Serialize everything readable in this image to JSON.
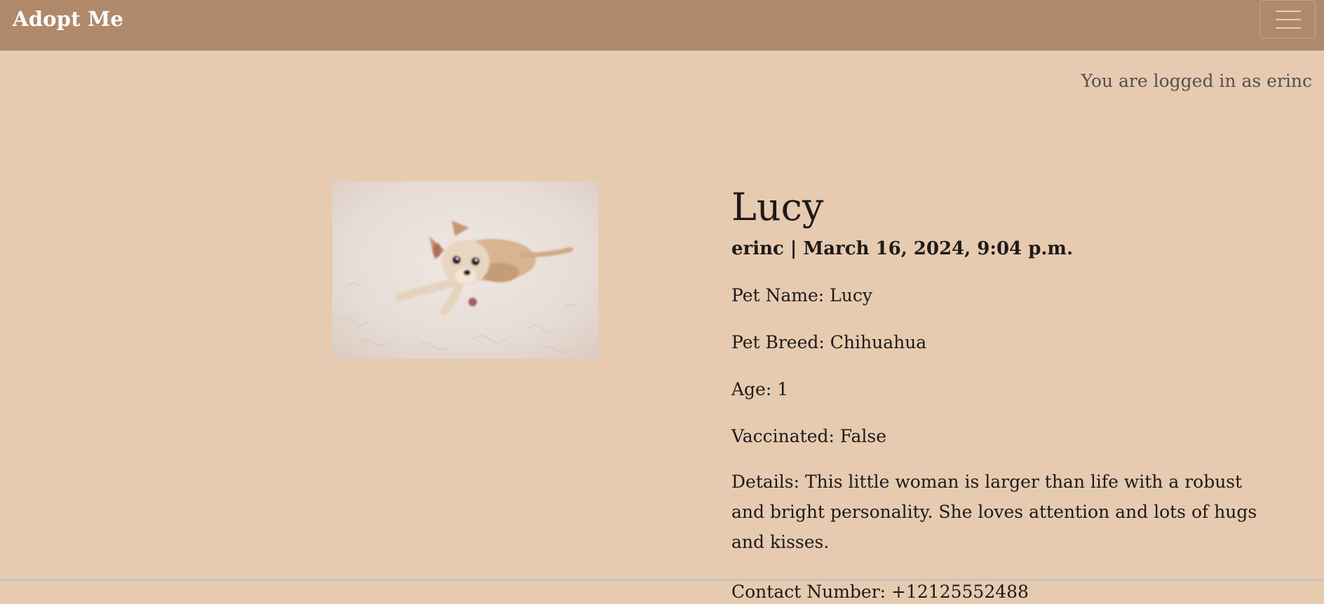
{
  "navbar": {
    "brand": "Adopt Me",
    "menu_icon": "hamburger-menu-icon"
  },
  "user": {
    "logged_in_text": "You are logged in as erinc"
  },
  "pet": {
    "image_alt": "Chihuahua dog lying on a white fluffy rug",
    "title": "Lucy",
    "meta": "erinc | March 16, 2024, 9:04 p.m.",
    "name_line": "Pet Name: Lucy",
    "breed_line": "Pet Breed: Chihuahua",
    "age_line": "Age: 1",
    "vaccinated_line": "Vaccinated: False",
    "details_line": "Details: This little woman is larger than life with a robust and bright personality. She loves attention and lots of hugs and kisses.",
    "contact_line": "Contact Number: +12125552488"
  },
  "colors": {
    "navbar": "#b0896a",
    "page_background": "#e6cbb1",
    "text": "#1e1a17",
    "muted_text": "#55504c"
  }
}
